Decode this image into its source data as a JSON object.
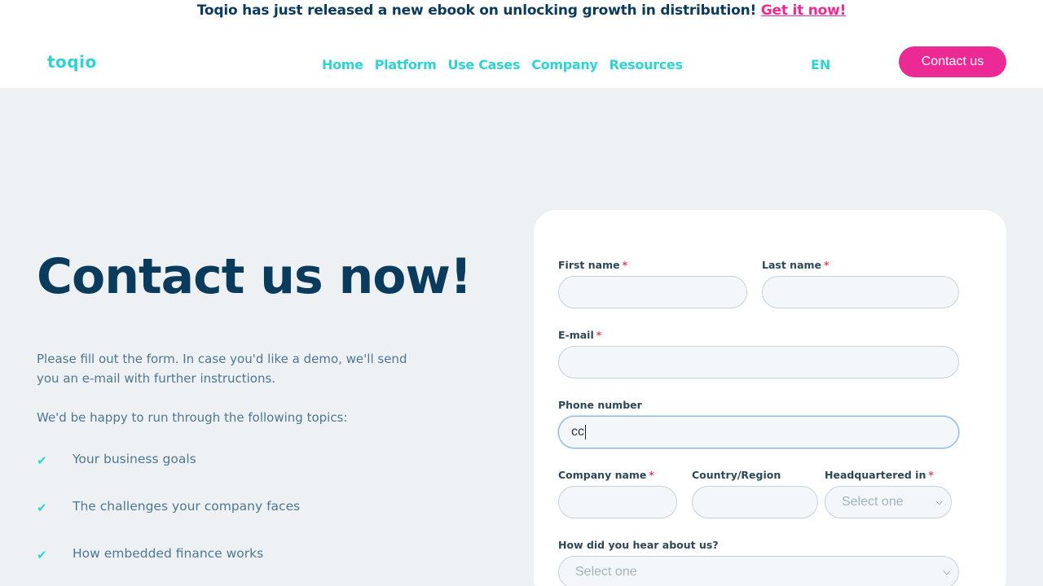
{
  "announcement": {
    "text": "Toqio has just released a new ebook on unlocking growth in distribution!",
    "link": "Get it now!"
  },
  "header": {
    "logo": "toqio",
    "nav": [
      "Home",
      "Platform",
      "Use Cases",
      "Company",
      "Resources"
    ],
    "language": "EN",
    "contact_button": "Contact us"
  },
  "hero": {
    "title": "Contact us now!",
    "intro": "Please fill out the form. In case you'd like a demo, we'll send you an e-mail with further instructions.",
    "topics_intro": "We'd be happy to run through the following topics:",
    "topics": [
      "Your business goals",
      "The challenges your company faces",
      "How embedded finance works"
    ]
  },
  "form": {
    "first_name": {
      "label": "First name",
      "required": "*",
      "value": ""
    },
    "last_name": {
      "label": "Last name",
      "required": "*",
      "value": ""
    },
    "email": {
      "label": "E-mail",
      "required": "*",
      "value": ""
    },
    "phone": {
      "label": "Phone number",
      "value": "cc"
    },
    "company": {
      "label": "Company name",
      "required": "*",
      "value": ""
    },
    "country": {
      "label": "Country/Region",
      "value": ""
    },
    "headquartered": {
      "label": "Headquartered in",
      "required": "*",
      "selected": "Select one"
    },
    "heard_about": {
      "label": "How did you hear about us?",
      "selected": "Select one"
    }
  },
  "colors": {
    "accent_cyan": "#2fd3d3",
    "accent_pink": "#ec2a95",
    "navy": "#0b3b5c",
    "background": "#eef1f4"
  },
  "icons": {
    "chevron": "chevron-down-icon",
    "check": "check-icon"
  }
}
